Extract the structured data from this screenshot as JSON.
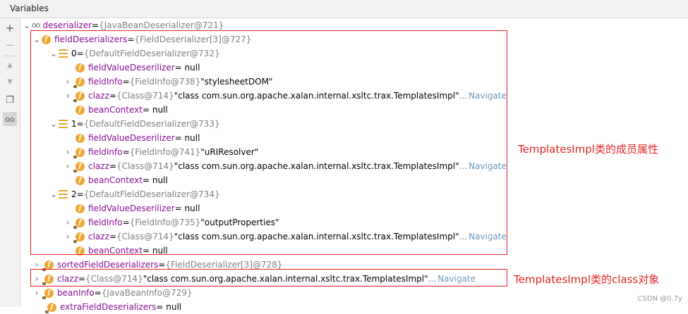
{
  "header": {
    "title": "Variables"
  },
  "toolbar": {
    "add_icon": "+",
    "remove_icon": "−",
    "up_icon": "▲",
    "down_icon": "▼",
    "copy_icon": "❐",
    "watch_icon": "oo"
  },
  "tree": {
    "root": {
      "name": "deserializer",
      "eq": " = ",
      "type": "{JavaBeanDeserializer@721}"
    },
    "field_deserializers": {
      "name": "fieldDeserializers",
      "eq": " = ",
      "type": "{FieldDeserializer[3]@727}"
    },
    "items": [
      {
        "index": "0",
        "eq": " = ",
        "type": "{DefaultFieldDeserializer@732}",
        "fvd": {
          "name": "fieldValueDeserilizer",
          "value": " = null"
        },
        "fieldInfo": {
          "name": "fieldInfo",
          "eq": " = ",
          "type": "{FieldInfo@738}",
          "value": " \"stylesheetDOM\""
        },
        "clazz": {
          "name": "clazz",
          "eq": " = ",
          "type": "{Class@714}",
          "value": " \"class com.sun.org.apache.xalan.internal.xsltc.trax.TemplatesImpl\"",
          "ellipsis": "...",
          "navigate": "Navigate"
        },
        "beanContext": {
          "name": "beanContext",
          "value": " = null"
        }
      },
      {
        "index": "1",
        "eq": " = ",
        "type": "{DefaultFieldDeserializer@733}",
        "fvd": {
          "name": "fieldValueDeserilizer",
          "value": " = null"
        },
        "fieldInfo": {
          "name": "fieldInfo",
          "eq": " = ",
          "type": "{FieldInfo@741}",
          "value": " \"uRIResolver\""
        },
        "clazz": {
          "name": "clazz",
          "eq": " = ",
          "type": "{Class@714}",
          "value": " \"class com.sun.org.apache.xalan.internal.xsltc.trax.TemplatesImpl\"",
          "ellipsis": "...",
          "navigate": "Navigate"
        },
        "beanContext": {
          "name": "beanContext",
          "value": " = null"
        }
      },
      {
        "index": "2",
        "eq": " = ",
        "type": "{DefaultFieldDeserializer@734}",
        "fvd": {
          "name": "fieldValueDeserilizer",
          "value": " = null"
        },
        "fieldInfo": {
          "name": "fieldInfo",
          "eq": " = ",
          "type": "{FieldInfo@735}",
          "value": " \"outputProperties\""
        },
        "clazz": {
          "name": "clazz",
          "eq": " = ",
          "type": "{Class@714}",
          "value": " \"class com.sun.org.apache.xalan.internal.xsltc.trax.TemplatesImpl\"",
          "ellipsis": "...",
          "navigate": "Navigate"
        },
        "beanContext": {
          "name": "beanContext",
          "value": " = null"
        }
      }
    ],
    "sorted": {
      "name": "sortedFieldDeserializers",
      "eq": " = ",
      "type": "{FieldDeserializer[3]@728}"
    },
    "clazz_top": {
      "name": "clazz",
      "eq": " = ",
      "type": "{Class@714}",
      "value": " \"class com.sun.org.apache.xalan.internal.xsltc.trax.TemplatesImpl\"",
      "ellipsis": "...",
      "navigate": "Navigate"
    },
    "beanInfo": {
      "name": "beanInfo",
      "eq": " = ",
      "type": "{JavaBeanInfo@729}"
    },
    "extra": {
      "name": "extraFieldDeserializers",
      "value": " = null"
    }
  },
  "annotations": {
    "members": "TemplatesImpl类的成员属性",
    "class_obj": "TemplatesImpl类的class对象"
  },
  "watermark": "CSDN @0.7y",
  "colors": {
    "field_name": "#871094",
    "type": "#808080",
    "navigate": "#6897bb",
    "annotation": "#e02424",
    "field_icon": "#f0a732"
  }
}
